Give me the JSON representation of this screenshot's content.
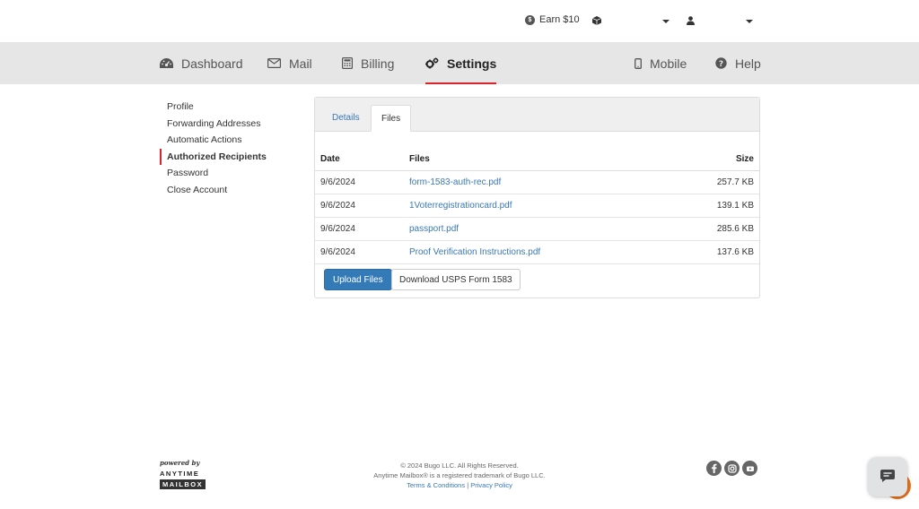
{
  "topbar": {
    "earn_label": "Earn $10",
    "earn_icon": "coin-icon",
    "box_icon": "box-icon",
    "user_icon": "user-icon"
  },
  "nav": {
    "dashboard": "Dashboard",
    "mail": "Mail",
    "billing": "Billing",
    "settings": "Settings",
    "mobile": "Mobile",
    "help": "Help",
    "active": "Settings"
  },
  "sidebar": {
    "items": [
      {
        "label": "Profile"
      },
      {
        "label": "Forwarding Addresses"
      },
      {
        "label": "Automatic Actions"
      },
      {
        "label": "Authorized Recipients"
      },
      {
        "label": "Password"
      },
      {
        "label": "Close Account"
      }
    ],
    "active": "Authorized Recipients"
  },
  "panel": {
    "tabs": [
      {
        "label": "Details"
      },
      {
        "label": "Files"
      }
    ],
    "active_tab": "Files",
    "table": {
      "headers": {
        "date": "Date",
        "files": "Files",
        "size": "Size"
      },
      "rows": [
        {
          "date": "9/6/2024",
          "file": "form-1583-auth-rec.pdf",
          "size": "257.7 KB"
        },
        {
          "date": "9/6/2024",
          "file": "1Voterregistrationcard.pdf",
          "size": "139.1 KB"
        },
        {
          "date": "9/6/2024",
          "file": "passport.pdf",
          "size": "285.6 KB"
        },
        {
          "date": "9/6/2024",
          "file": "Proof Verification Instructions.pdf",
          "size": "137.6 KB"
        }
      ]
    },
    "upload_label": "Upload Files",
    "download_label": "Download USPS Form 1583"
  },
  "footer": {
    "logo_powered": "powered by",
    "logo_anytime": "ANYTIME",
    "logo_mailbox": "MAILBOX",
    "copyright": "© 2024 Bugo LLC. All Rights Reserved.",
    "trademark": "Anytime Mailbox® is a registered trademark of Bugo LLC.",
    "terms": "Terms & Conditions",
    "separator": " | ",
    "privacy": "Privacy Policy"
  },
  "colors": {
    "accent_red": "#d9262e",
    "link_blue": "#3a78b5",
    "primary_button": "#337ab7",
    "nav_bg": "#e6e6e6",
    "chat_orange": "#e8731c"
  }
}
